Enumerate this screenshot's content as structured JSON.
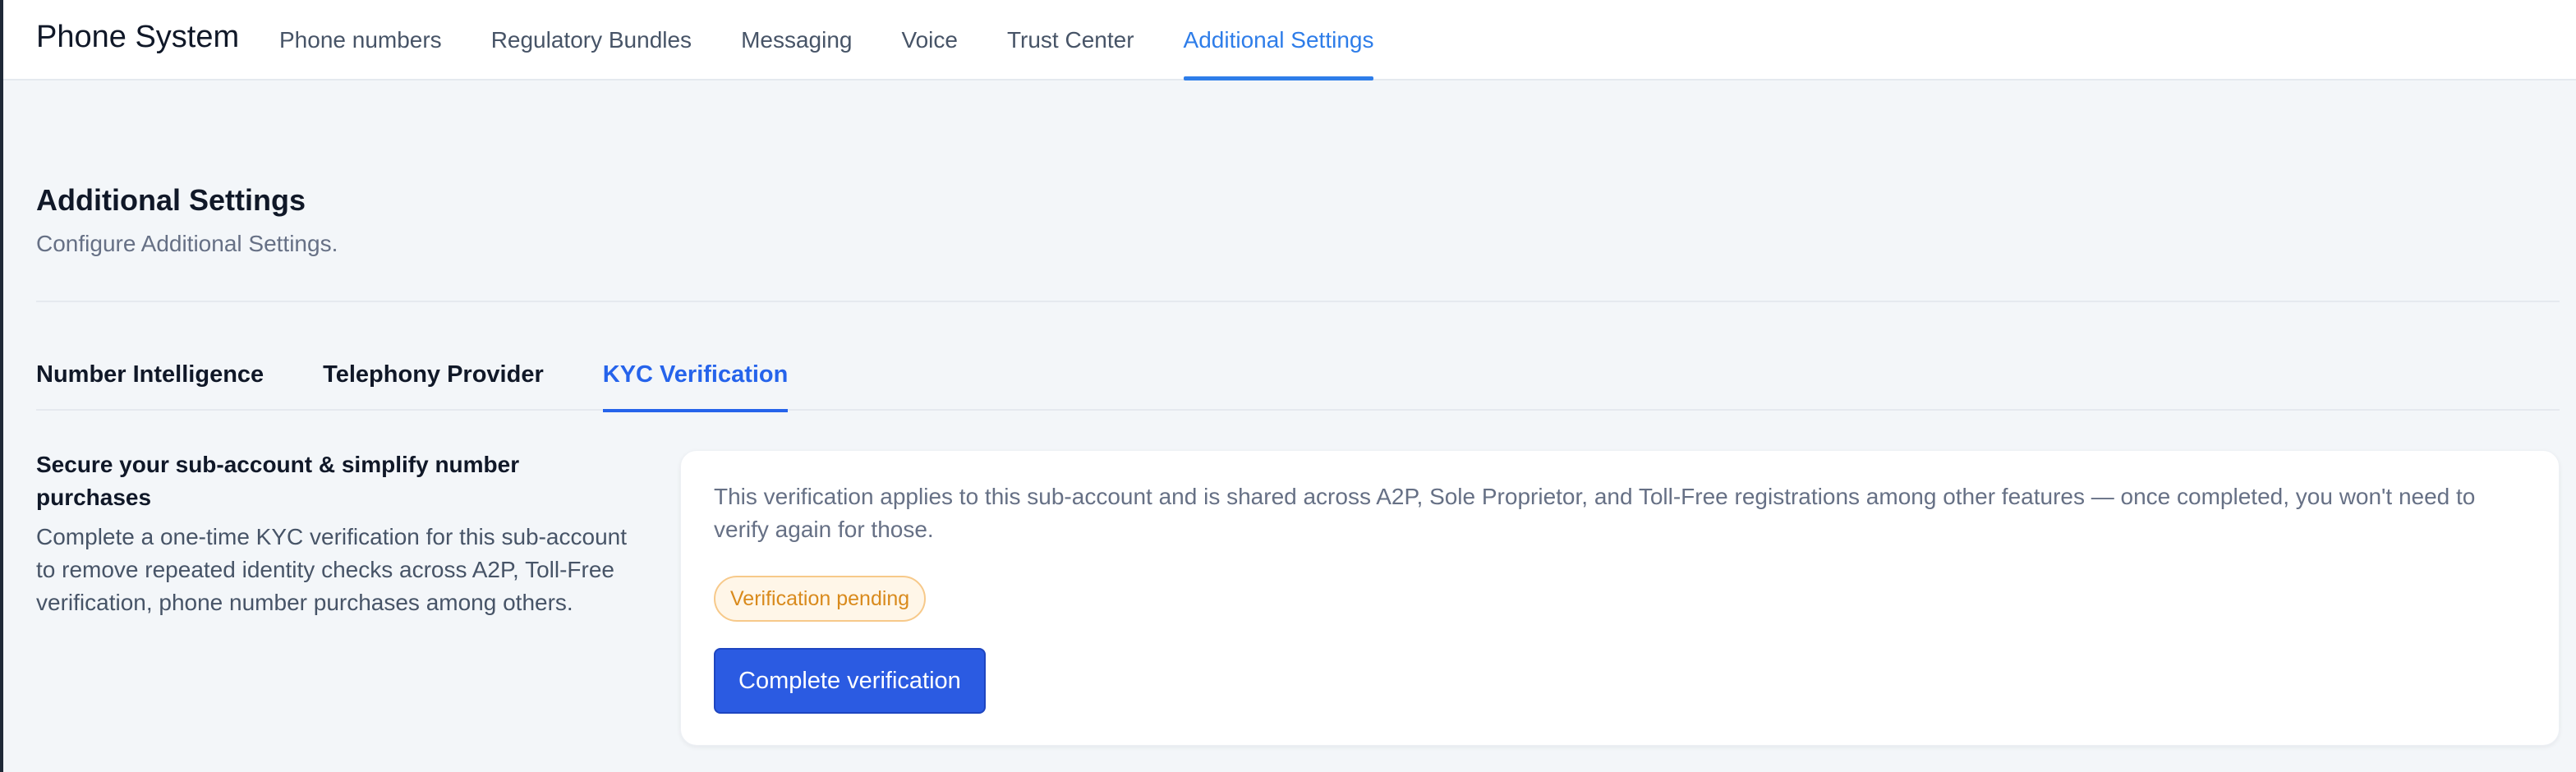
{
  "app": {
    "title": "Phone System"
  },
  "topnav": {
    "items": [
      {
        "label": "Phone numbers",
        "active": false
      },
      {
        "label": "Regulatory Bundles",
        "active": false
      },
      {
        "label": "Messaging",
        "active": false
      },
      {
        "label": "Voice",
        "active": false
      },
      {
        "label": "Trust Center",
        "active": false
      },
      {
        "label": "Additional Settings",
        "active": true
      }
    ]
  },
  "page": {
    "title": "Additional Settings",
    "subtitle": "Configure Additional Settings."
  },
  "subtabs": {
    "items": [
      {
        "label": "Number Intelligence",
        "active": false
      },
      {
        "label": "Telephony Provider",
        "active": false
      },
      {
        "label": "KYC Verification",
        "active": true
      }
    ]
  },
  "kyc": {
    "section_title": "Secure your sub-account & simplify number purchases",
    "section_description": "Complete a one-time KYC verification for this sub-account to remove repeated identity checks across A2P, Toll-Free verification, phone number purchases among others.",
    "card_text": "This verification applies to this sub-account and is shared across A2P, Sole Proprietor, and Toll-Free registrations among other features — once completed, you won't need to verify again for those.",
    "status_badge": "Verification pending",
    "action_label": "Complete verification"
  },
  "colors": {
    "accent": "#2e7de9",
    "primary_button": "#2b5be2",
    "pending_badge_text": "#d98a1c",
    "pending_badge_bg": "#fff6e8",
    "page_background": "#f3f6f9"
  }
}
